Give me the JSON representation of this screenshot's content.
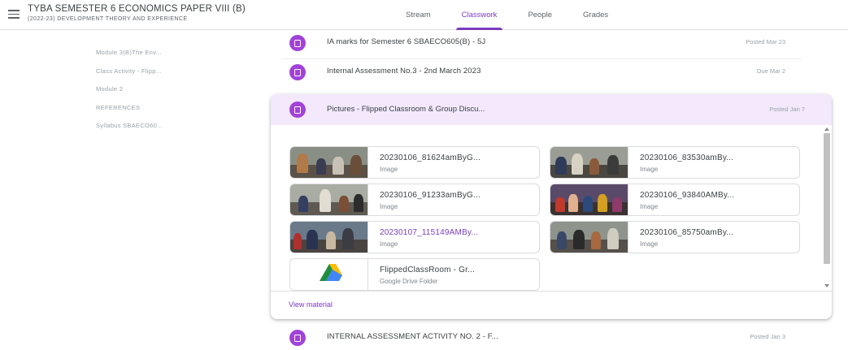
{
  "header": {
    "class_title": "TYBA SEMESTER 6 ECONOMICS PAPER VIII (B)",
    "class_subtitle": "(2022-23) DEVELOPMENT THEORY AND EXPERIENCE",
    "tabs": [
      {
        "label": "Stream",
        "active": false
      },
      {
        "label": "Classwork",
        "active": true
      },
      {
        "label": "People",
        "active": false
      },
      {
        "label": "Grades",
        "active": false
      }
    ]
  },
  "topics": [
    "Module 3(B)The Env...",
    "Class Activity - Flipp...",
    "Module 2",
    "REFERENCES",
    "Syllabus SBAECO60..."
  ],
  "rows": [
    {
      "title": "IA marks for Semester 6 SBAECO605(B) - 5J",
      "meta": "Posted Mar 23"
    },
    {
      "title": "Internal Assessment No.3 - 2nd March 2023",
      "meta": "Due Mar 2"
    }
  ],
  "expanded": {
    "title": "Pictures - Flipped Classroom & Group Discu...",
    "meta": "Posted Jan 7",
    "attachments": [
      {
        "name": "20230106_81624amByG...",
        "type": "Image",
        "visited": false
      },
      {
        "name": "20230106_83530amBy...",
        "type": "Image",
        "visited": false
      },
      {
        "name": "20230106_91233amByG...",
        "type": "Image",
        "visited": false
      },
      {
        "name": "20230106_93840AMBy...",
        "type": "Image",
        "visited": false
      },
      {
        "name": "20230107_115149AMBy...",
        "type": "Image",
        "visited": true
      },
      {
        "name": "20230106_85750amBy...",
        "type": "Image",
        "visited": false
      },
      {
        "name": "FlippedClassRoom - Gr...",
        "type": "Google Drive Folder",
        "visited": false
      }
    ],
    "view_material": "View material"
  },
  "bottom_row": {
    "title": "INTERNAL ASSESSMENT ACTIVITY NO. 2 - F...",
    "meta": "Posted Jan 3"
  },
  "colors": {
    "accent": "#7b3bbf",
    "icon_purple": "#a142d8",
    "card_header": "#f3e8fc"
  }
}
